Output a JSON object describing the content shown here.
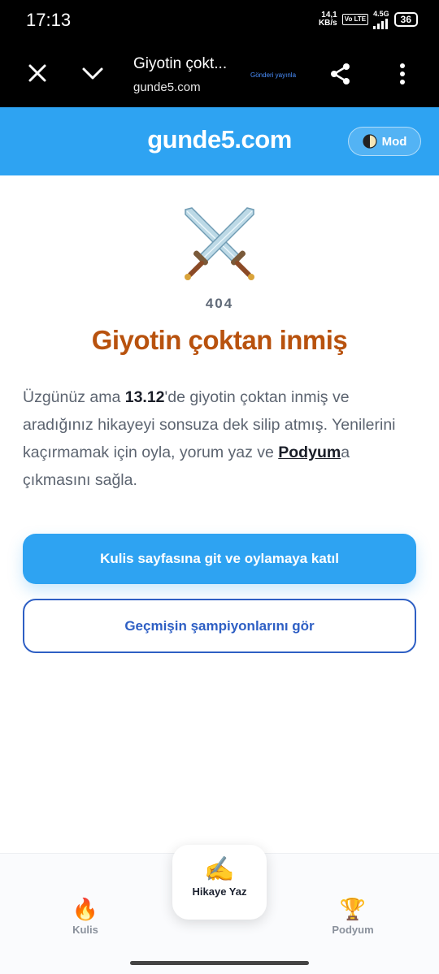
{
  "status_bar": {
    "time": "17:13",
    "net_speed_value": "14,1",
    "net_speed_unit": "KB/s",
    "volte": "Vo LTE",
    "network": "4.5G",
    "battery": "36"
  },
  "tab": {
    "title": "Giyotin çokt...",
    "url": "gunde5.com",
    "posted": "Gönderi yayınla"
  },
  "header": {
    "logo": "gunde5.com",
    "mode_label": "Mod"
  },
  "error": {
    "code": "404",
    "title": "Giyotin çoktan inmiş",
    "desc_part1": "Üzgünüz ama ",
    "desc_date": "13.12",
    "desc_part2": "'de giyotin çoktan inmiş ve aradığınız hikayeyi sonsuza dek silip atmış. Yenilerini kaçırmamak için oyla, yorum yaz ve ",
    "desc_link": "Podyum",
    "desc_part3": "a çıkmasını sağla."
  },
  "buttons": {
    "primary": "Kulis sayfasına git ve oylamaya katıl",
    "secondary": "Geçmişin şampiyonlarını gör"
  },
  "nav": {
    "kulis_icon": "🔥",
    "kulis": "Kulis",
    "write_icon": "✍️",
    "write": "Hikaye Yaz",
    "podyum_icon": "🏆",
    "podyum": "Podyum"
  },
  "icons": {
    "close": "close-icon",
    "chevron": "chevron-down-icon",
    "share": "share-icon",
    "more": "more-vert-icon",
    "mode": "half-moon-icon",
    "hero": "crossed-swords-icon"
  },
  "colors": {
    "brand": "#2ea3f2",
    "title": "#b8520e",
    "outline": "#2e5fc4"
  }
}
